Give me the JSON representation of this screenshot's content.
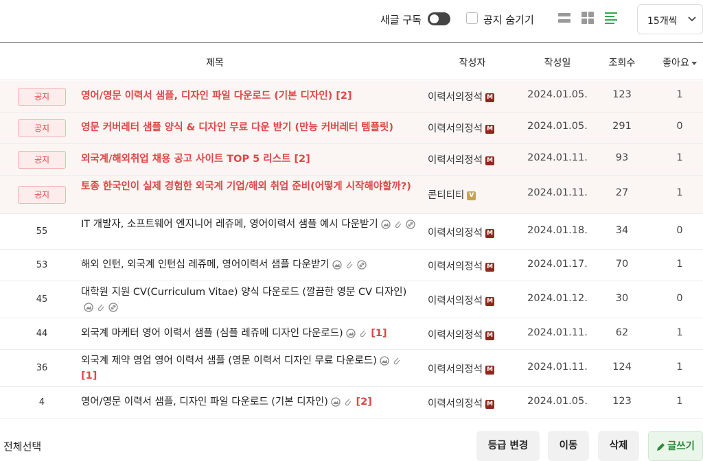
{
  "toolbar": {
    "subscribe_label": "새글 구독",
    "hide_notice_label": "공지 숨기기",
    "per_page": "15개씩",
    "view_modes": [
      "list-view-icon",
      "card-view-icon",
      "text-list-view-icon"
    ],
    "active_view_color": "#2fa84f"
  },
  "columns": {
    "title": "제목",
    "author": "작성자",
    "date": "작성일",
    "views": "조회수",
    "likes": "좋아요"
  },
  "notices": [
    {
      "badge": "공지",
      "title": "영어/영문 이력서 샘플, 디자인 파일 다운로드 (기본 디자인)",
      "comments": "[2]",
      "author": "이력서의정석",
      "level": "M",
      "date": "2024.01.05.",
      "views": "123",
      "likes": "1"
    },
    {
      "badge": "공지",
      "title": "영문 커버레터 샘플 양식 & 디자인 무료 다운 받기 (만능 커버레터 템플릿)",
      "comments": "",
      "author": "이력서의정석",
      "level": "M",
      "date": "2024.01.05.",
      "views": "291",
      "likes": "0"
    },
    {
      "badge": "공지",
      "title": "외국계/해외취업 채용 공고 사이트 TOP 5 리스트",
      "comments": "[2]",
      "author": "이력서의정석",
      "level": "M",
      "date": "2024.01.11.",
      "views": "93",
      "likes": "1"
    },
    {
      "badge": "공지",
      "title": "토종 한국인이 실제 경험한 외국계 기업/해외 취업 준비(어떻게 시작해야할까?)",
      "comments": "",
      "author": "콘티티티",
      "level": "V",
      "date": "2024.01.11.",
      "views": "27",
      "likes": "1"
    }
  ],
  "posts": [
    {
      "num": "55",
      "title": "IT 개발자, 소프트웨어 엔지니어 레쥬메, 영어이력서 샘플 예시 다운받기",
      "comments": "",
      "author": "이력서의정석",
      "level": "M",
      "date": "2024.01.18.",
      "views": "34",
      "likes": "0"
    },
    {
      "num": "53",
      "title": "해외 인턴, 외국계 인턴십 레쥬메, 영어이력서 샘플 다운받기",
      "comments": "",
      "author": "이력서의정석",
      "level": "M",
      "date": "2024.01.17.",
      "views": "70",
      "likes": "1"
    },
    {
      "num": "45",
      "title": "대학원 지원 CV(Curriculum Vitae) 양식 다운로드 (깔끔한 영문 CV 디자인)",
      "comments": "",
      "author": "이력서의정석",
      "level": "M",
      "date": "2024.01.12.",
      "views": "30",
      "likes": "0"
    },
    {
      "num": "44",
      "title": "외국계 마케터 영어 이력서 샘플 (심플 레쥬메 디자인 다운로드)",
      "comments": "[1]",
      "author": "이력서의정석",
      "level": "M",
      "date": "2024.01.11.",
      "views": "62",
      "likes": "1"
    },
    {
      "num": "36",
      "title": "외국계 제약 영업 영어 이력서 샘플 (영문 이력서 디자인 무료 다운로드)",
      "comments": "[1]",
      "author": "이력서의정석",
      "level": "M",
      "date": "2024.01.11.",
      "views": "124",
      "likes": "1"
    },
    {
      "num": "4",
      "title": "영어/영문 이력서 샘플, 디자인 파일 다운로드 (기본 디자인)",
      "comments": "[2]",
      "author": "이력서의정석",
      "level": "M",
      "date": "2024.01.05.",
      "views": "123",
      "likes": "1"
    }
  ],
  "footer": {
    "select_all": "전체선택",
    "grade_change": "등급 변경",
    "move": "이동",
    "delete": "삭제",
    "write": "글쓰기"
  },
  "colors": {
    "notice_red": "#e04646",
    "notice_bg": "#fbf6f4",
    "write_green": "#2c8a3a"
  }
}
